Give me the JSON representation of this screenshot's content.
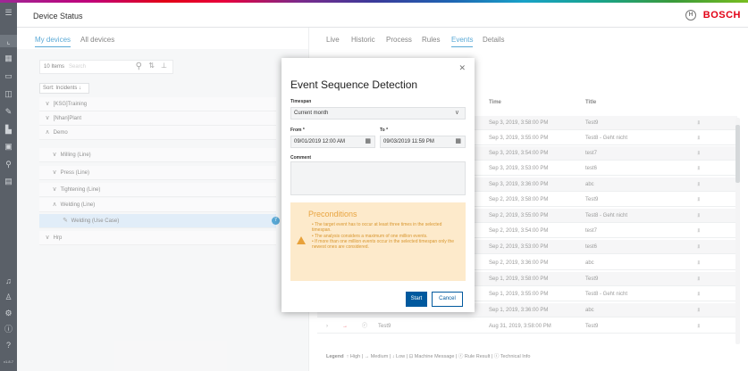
{
  "app": {
    "title": "Device Status",
    "brand": "BOSCH",
    "brand_color": "#e20015",
    "accent": "#007bc0"
  },
  "sidebar_icons": [
    "menu-icon",
    "chart-icon",
    "grid-icon",
    "device-icon",
    "ticket-icon",
    "tool-icon",
    "factory-icon",
    "monitor-icon",
    "location-icon",
    "building-icon",
    "bell-icon",
    "user-icon",
    "settings-icon",
    "info-icon",
    "help-icon"
  ],
  "leftnav": {
    "version": "v1.8.7"
  },
  "tabs_left": [
    {
      "label": "My devices"
    },
    {
      "label": "All devices"
    }
  ],
  "tabs_right": [
    {
      "label": "Live"
    },
    {
      "label": "Historic"
    },
    {
      "label": "Process"
    },
    {
      "label": "Rules"
    },
    {
      "label": "Events"
    },
    {
      "label": "Details"
    }
  ],
  "list": {
    "count": "10 Items",
    "search_placeholder": "Search",
    "sort_label": "Sort: Incidents ↓"
  },
  "tree": [
    {
      "label": "[KSG]Training",
      "chev": "∨"
    },
    {
      "label": "[Nhan]Plant",
      "chev": "∨"
    },
    {
      "label": "Demo",
      "chev": "∧"
    },
    {
      "label": "Milling (Line)",
      "chev": "∨"
    },
    {
      "label": "Press (Line)",
      "chev": "∨"
    },
    {
      "label": "Tightening (Line)",
      "chev": "∨"
    },
    {
      "label": "Welding (Line)",
      "chev": "∧"
    },
    {
      "label": "Welding (Use Case)",
      "badge": "7"
    },
    {
      "label": "Hrp",
      "chev": "∨"
    }
  ],
  "table": {
    "headers": {
      "time": "Time",
      "title": "Title"
    },
    "rows": [
      {
        "time": "Sep 3, 2019, 3:58:00 PM",
        "title": "Test9"
      },
      {
        "time": "Sep 3, 2019, 3:55:00 PM",
        "title": "Test8 - Geht nicht"
      },
      {
        "time": "Sep 3, 2019, 3:54:00 PM",
        "title": "test7"
      },
      {
        "time": "Sep 3, 2019, 3:53:00 PM",
        "title": "test6"
      },
      {
        "time": "Sep 3, 2019, 3:36:00 PM",
        "title": "abc"
      },
      {
        "time": "Sep 2, 2019, 3:58:00 PM",
        "title": "Test9"
      },
      {
        "time": "Sep 2, 2019, 3:55:00 PM",
        "title": "Test8 - Geht nicht"
      },
      {
        "time": "Sep 2, 2019, 3:54:00 PM",
        "title": "test7"
      },
      {
        "time": "Sep 2, 2019, 3:53:00 PM",
        "title": "test6"
      },
      {
        "time": "Sep 2, 2019, 3:36:00 PM",
        "title": "abc"
      },
      {
        "time": "Sep 1, 2019, 3:58:00 PM",
        "title": "Test9"
      },
      {
        "time": "Sep 1, 2019, 3:55:00 PM",
        "title": "Test8 - Geht nicht"
      },
      {
        "time": "Sep 1, 2019, 3:36:00 PM",
        "title": "abc",
        "name": "abc"
      },
      {
        "time": "Aug 31, 2019, 3:58:00 PM",
        "title": "Test9",
        "name": "Test9"
      }
    ]
  },
  "legend": {
    "label": "Legend",
    "items": "↑ High | → Medium | ↓ Low | ⊡ Machine Message | ⓡ Rule Result | ⓘ Technical Info"
  },
  "modal": {
    "title": "Event Sequence Detection",
    "timespan_label": "Timespan",
    "timespan_value": "Current month",
    "from_label": "From *",
    "from_value": "09/01/2019 12:00 AM",
    "to_label": "To *",
    "to_value": "09/03/2019 11:59 PM",
    "comment_label": "Comment",
    "preconditions_title": "Preconditions",
    "preconditions": [
      "• The target event has to occur at least three times in the selected timespan.",
      "• The analysis considers a maximum of one million events.",
      "• If more than one million events occur in the selected timespan only the newest ones are considered."
    ],
    "start_label": "Start",
    "cancel_label": "Cancel"
  }
}
